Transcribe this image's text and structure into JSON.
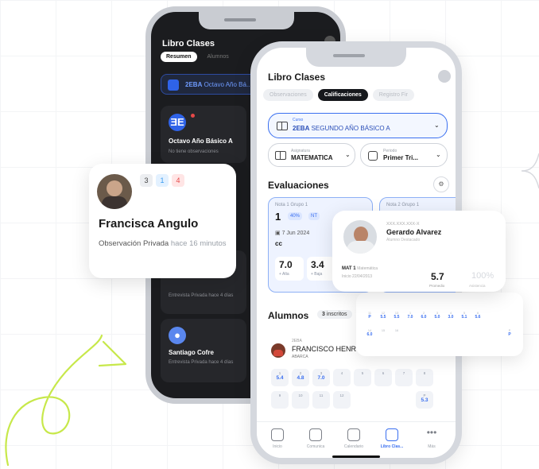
{
  "colors": {
    "accent": "#3a6ff0",
    "dark_bg": "#1b1c1f",
    "doodle": "#c7e84a",
    "red_badge": "#e54848"
  },
  "dark_phone": {
    "title": "Libro Clases",
    "tabs": [
      "Resumen",
      "Alumnos"
    ],
    "course_code": "2EBA",
    "course_name": "Octavo Año Bá...",
    "cards": [
      {
        "title": "Octavo Año Básico A",
        "subtitle": "No tiene observaciones"
      },
      {
        "title": "",
        "subtitle": "Entrevista Privada hace 4 días"
      },
      {
        "title": "Santiago Cofre",
        "subtitle": "Entrevista Privada hace 4 días"
      }
    ]
  },
  "light_phone": {
    "title": "Libro Clases",
    "tabs": [
      "Observaciones",
      "Calificaciones",
      "Registro Fir"
    ],
    "active_tab": "Calificaciones",
    "course": {
      "label": "Curso",
      "code": "2EBA",
      "name": "SEGUNDO AÑO BÁSICO A"
    },
    "subject": {
      "label": "Asignatura",
      "value": "MATEMATICA"
    },
    "period": {
      "label": "Periodo",
      "value": "Primer Tri..."
    },
    "evaluations_title": "Evaluaciones",
    "evaluations": [
      {
        "header": "Nota 1 Grupo 1",
        "number": "1",
        "percent": "40%",
        "type": "NT",
        "date": "7 Jun 2024",
        "code": "cc",
        "high": "7.0",
        "high_label": "+ Alta",
        "low": "3.4",
        "low_label": "+ Baja"
      },
      {
        "header": "Nota 2 Grupo 1",
        "number": "",
        "percent": "",
        "type": "",
        "date": "",
        "code": "",
        "high": "",
        "high_label": "",
        "low": "",
        "low_label": ""
      }
    ],
    "students_title": "Alumnos",
    "inscritos_count": "3",
    "inscritos_label": "inscritos",
    "student": {
      "code": "2EBA",
      "name": "FRANCISCO HENR",
      "last": "ABARCA",
      "grades": [
        {
          "i": "1",
          "v": "5.4"
        },
        {
          "i": "2",
          "v": "4.8"
        },
        {
          "i": "3",
          "v": "7.0"
        },
        {
          "i": "4",
          "v": ""
        },
        {
          "i": "5",
          "v": ""
        },
        {
          "i": "6",
          "v": ""
        },
        {
          "i": "7",
          "v": ""
        },
        {
          "i": "8",
          "v": ""
        },
        {
          "i": "9",
          "v": ""
        },
        {
          "i": "10",
          "v": ""
        },
        {
          "i": "11",
          "v": ""
        },
        {
          "i": "12",
          "v": ""
        },
        {
          "i": "P",
          "v": "5.3"
        }
      ]
    },
    "nav": [
      {
        "label": "Inicio",
        "icon": "home-icon"
      },
      {
        "label": "Comunica",
        "icon": "chat-icon"
      },
      {
        "label": "Calendario",
        "icon": "calendar-icon"
      },
      {
        "label": "Libro Clas...",
        "icon": "book-icon"
      },
      {
        "label": "Más",
        "icon": "more-icon"
      }
    ]
  },
  "francisca_card": {
    "badges": [
      "3",
      "1",
      "4"
    ],
    "name": "Francisca Angulo",
    "observation": "Observación Privada",
    "time": "hace 16 minutos"
  },
  "gerardo_card": {
    "code": "XXX.XXX.XXX-X",
    "name": "Gerardo Alvarez",
    "subtitle": "Alumno Destacado",
    "subject": "MAT 1",
    "subject_extra": "Matemática",
    "date": "Inicio 22/04/2013",
    "promedio": "5.7",
    "promedio_label": "Promedio",
    "asistencia": "100%",
    "asistencia_label": "Asistencia",
    "grades_row1": [
      {
        "i": "11",
        "v": "P"
      },
      {
        "i": "12",
        "v": "5.5"
      },
      {
        "i": "13",
        "v": "5.5"
      },
      {
        "i": "1",
        "v": "7.0"
      },
      {
        "i": "2",
        "v": "6.0"
      },
      {
        "i": "3",
        "v": "5.0"
      },
      {
        "i": "4",
        "v": "3.0"
      },
      {
        "i": "5",
        "v": "5.1"
      },
      {
        "i": "6",
        "v": "5.6"
      }
    ],
    "grades_row2": [
      {
        "i": "14",
        "v": "6.0"
      },
      {
        "i": "15",
        "v": ""
      },
      {
        "i": "16",
        "v": ""
      },
      {
        "i": "P",
        "v": "P"
      }
    ]
  }
}
